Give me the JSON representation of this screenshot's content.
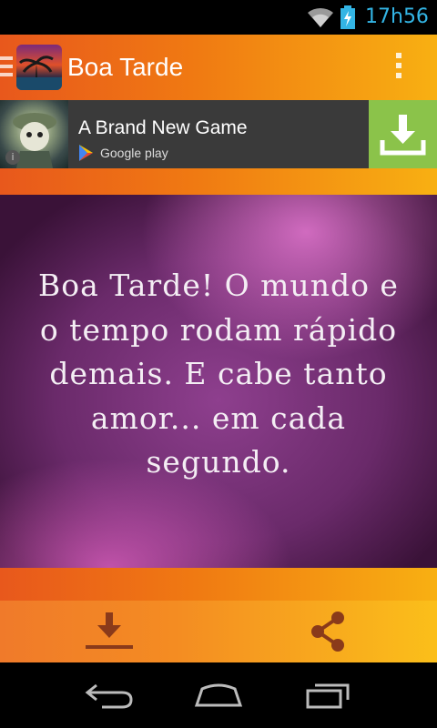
{
  "status_bar": {
    "time": "17h56",
    "icons": [
      "wifi-icon",
      "battery-charging-icon"
    ],
    "time_color": "#33b5e5"
  },
  "action_bar": {
    "title": "Boa Tarde",
    "icons": [
      "drawer-icon",
      "app-icon",
      "overflow-menu-icon"
    ]
  },
  "ad": {
    "title": "A Brand New Game",
    "store_label": "Google play",
    "download_color": "#8bc34a",
    "icons": [
      "game-icon",
      "info-icon",
      "google-play-icon",
      "download-icon"
    ]
  },
  "quote": {
    "text": "Boa Tarde! O mundo e o tempo rodam rápido demais. E cabe tanto amor... em cada segundo."
  },
  "toolbar": {
    "icons": [
      "save-download-icon",
      "share-icon"
    ]
  },
  "nav_bar": {
    "icons": [
      "back-icon",
      "home-icon",
      "recent-apps-icon"
    ]
  },
  "colors": {
    "accent_orange": "#f07a12",
    "accent_yellow": "#f8b012"
  }
}
